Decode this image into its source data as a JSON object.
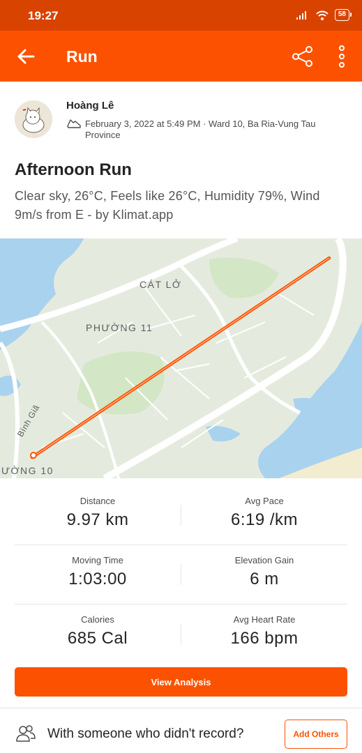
{
  "status_bar": {
    "time": "19:27",
    "battery": "58"
  },
  "app_bar": {
    "title": "Run"
  },
  "athlete": {
    "name": "Hoàng Lê"
  },
  "activity": {
    "meta": "February 3, 2022 at 5:49 PM · Ward 10, Ba Ria-Vung Tau Province",
    "title": "Afternoon Run",
    "description": "Clear sky, 26°C, Feels like 26°C, Humidity 79%, Wind 9m/s from E - by Klimat.app"
  },
  "map": {
    "labels": {
      "cat_lo": "CÁT LỞ",
      "phuong_11": "PHƯỜNG 11",
      "binh_gia": "Bình Giã",
      "phuong_10": "ƯỜNG 10"
    },
    "route_color": "#fc5200"
  },
  "stats": [
    {
      "label": "Distance",
      "value": "9.97 km"
    },
    {
      "label": "Avg Pace",
      "value": "6:19 /km"
    },
    {
      "label": "Moving Time",
      "value": "1:03:00"
    },
    {
      "label": "Elevation Gain",
      "value": "6 m"
    },
    {
      "label": "Calories",
      "value": "685 Cal"
    },
    {
      "label": "Avg Heart Rate",
      "value": "166 bpm"
    }
  ],
  "buttons": {
    "view_analysis": "View Analysis",
    "add_others": "Add Others"
  },
  "footer": {
    "prompt": "With someone who didn't record?"
  },
  "colors": {
    "brand": "#fc5200",
    "status_bar": "#d94300"
  },
  "icons": [
    "back-arrow-icon",
    "share-icon",
    "more-vertical-icon",
    "shoe-icon",
    "people-icon",
    "signal-icon",
    "wifi-icon",
    "battery-icon"
  ]
}
